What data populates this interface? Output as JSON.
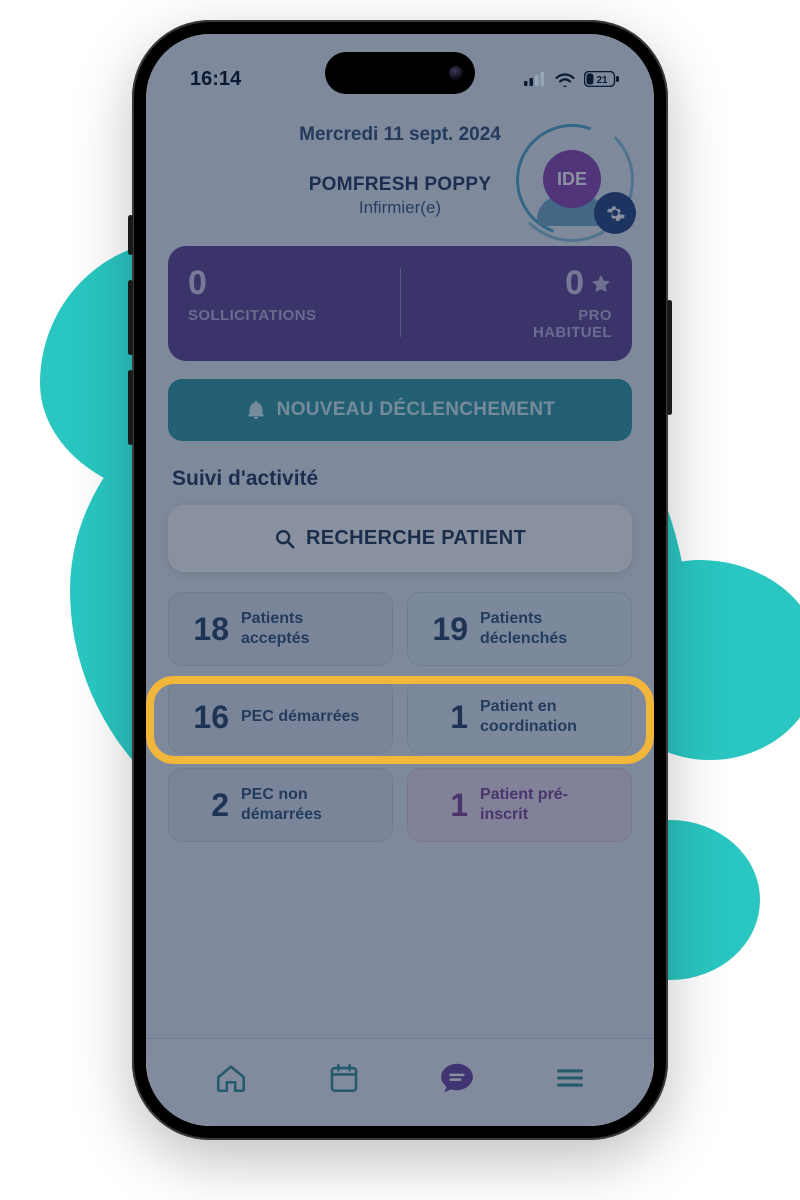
{
  "status": {
    "time": "16:14",
    "battery": "21"
  },
  "header": {
    "date": "Mercredi 11 sept. 2024",
    "name": "POMFRESH POPPY",
    "role": "Infirmier(e)",
    "badge": "IDE"
  },
  "stats": {
    "sollicitations_count": "0",
    "sollicitations_label": "SOLLICITATIONS",
    "pro_count": "0",
    "pro_label_line1": "PRO",
    "pro_label_line2": "HABITUEL"
  },
  "action": {
    "label": "NOUVEAU DÉCLENCHEMENT"
  },
  "section": {
    "title": "Suivi d'activité"
  },
  "search": {
    "label": "RECHERCHE PATIENT"
  },
  "tiles": [
    {
      "count": "18",
      "label": "Patients acceptés"
    },
    {
      "count": "19",
      "label": "Patients déclenchés"
    },
    {
      "count": "16",
      "label": "PEC démarrées"
    },
    {
      "count": "1",
      "label": "Patient en coordination"
    },
    {
      "count": "2",
      "label": "PEC non démarrées"
    },
    {
      "count": "1",
      "label": "Patient pré-inscrit"
    }
  ]
}
